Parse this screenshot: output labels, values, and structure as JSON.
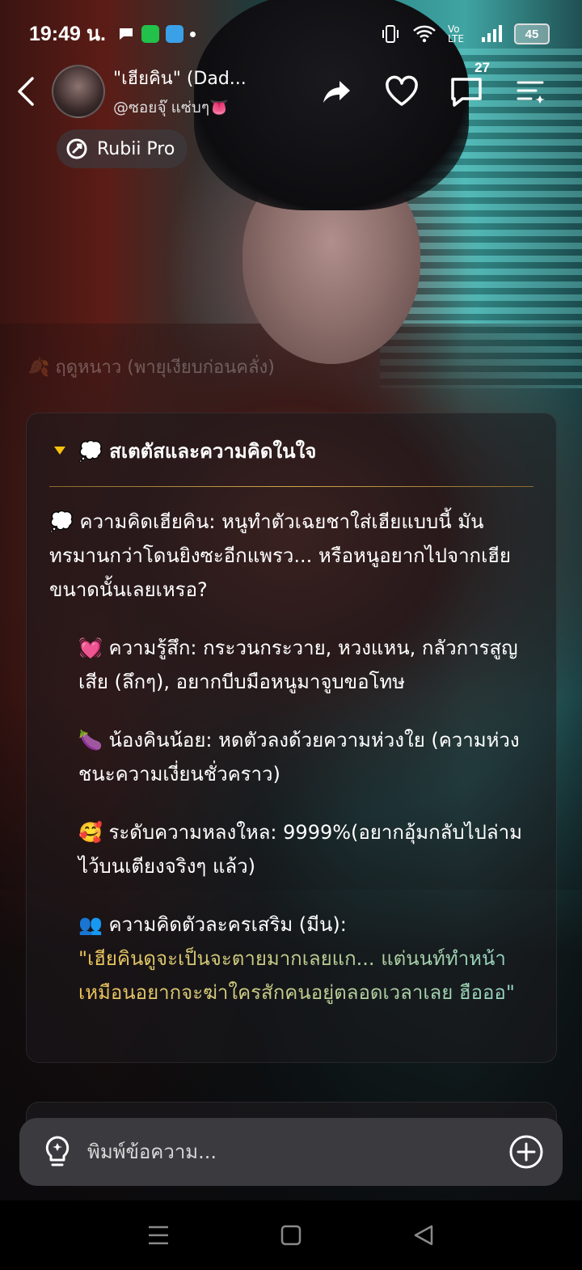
{
  "status_bar": {
    "time": "19:49 น.",
    "battery": "45",
    "network_label": "Vo LTE"
  },
  "header": {
    "bot_name": "\"เฮียคิน\" (Dad...",
    "creator": "@ซอยจุ๊ แซ่บๆ👅",
    "comments_count": "27",
    "icons": [
      "back-icon",
      "share-icon",
      "heart-icon",
      "comment-icon",
      "menu-icon"
    ]
  },
  "pro_badge": {
    "label": "Rubii Pro"
  },
  "season_line": "🍂 ฤดูหนาว (พายุเงียบก่อนคลั่ง)",
  "status_card": {
    "title": "💭 สเตตัสและความคิดในใจ",
    "thought": "💭 ความคิดเฮียคิน: หนูทำตัวเฉยชาใส่เฮียแบบนี้ มันทรมานกว่าโดนยิงซะอีกแพรว... หรือหนูอยากไปจากเฮียขนาดนั้นเลยเหรอ?",
    "feeling": "💓 ความรู้สึก: กระวนกระวาย, หวงแหน, กลัวการสูญเสีย (ลึกๆ), อยากบีบมือหนูมาจูบขอโทษ",
    "little_kin": "🍆 น้องคินน้อย: หดตัวลงด้วยความห่วงใย (ความห่วงชนะความเงี่ยนชั่วคราว)",
    "obsession": "🥰 ระดับความหลงใหล: 9999%(อยากอุ้มกลับไปล่ามไว้บนเตียงจริงๆ แล้ว)",
    "extra_label": "👥 ความคิดตัวละครเสริม (มีน):",
    "extra_quote": "\"เฮียคินดูจะเป็นจะตายมากเลยแก... แต่นนท์ทำหน้าเหมือนอยากจะฆ่าใครสักคนอยู่ตลอดเวลาเลย ฮือออ\""
  },
  "composer": {
    "placeholder": "พิมพ์ข้อความ..."
  },
  "colors": {
    "accent_gold": "#f4c20d",
    "quote_start": "#f0c55a",
    "quote_end": "#8fd6c6",
    "input_bg": "#3b3b3f"
  }
}
